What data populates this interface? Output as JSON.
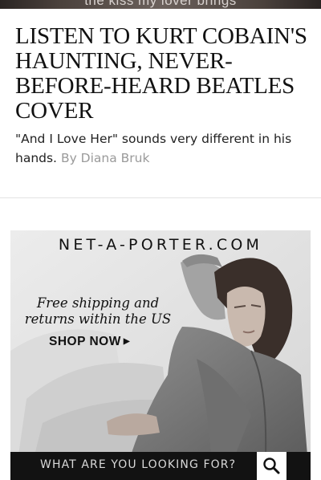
{
  "top_image": {
    "caption": "the kiss my lover brings"
  },
  "article": {
    "headline": "LISTEN TO KURT COBAIN'S HAUNTING, NEVER-BEFORE-HEARD BEATLES COVER",
    "dek": "\"And I Love Her\" sounds very different in his hands.",
    "byline": "By Diana Bruk"
  },
  "ad": {
    "logo": "NET-A-PORTER.COM",
    "offer_line1": "Free shipping and",
    "offer_line2": "returns within the US",
    "cta_label": "SHOP NOW",
    "search_prompt": "WHAT ARE YOU LOOKING FOR?",
    "search_icon": "search-icon"
  },
  "colors": {
    "search_bar": "#121212",
    "byline": "#9a9a9a"
  }
}
